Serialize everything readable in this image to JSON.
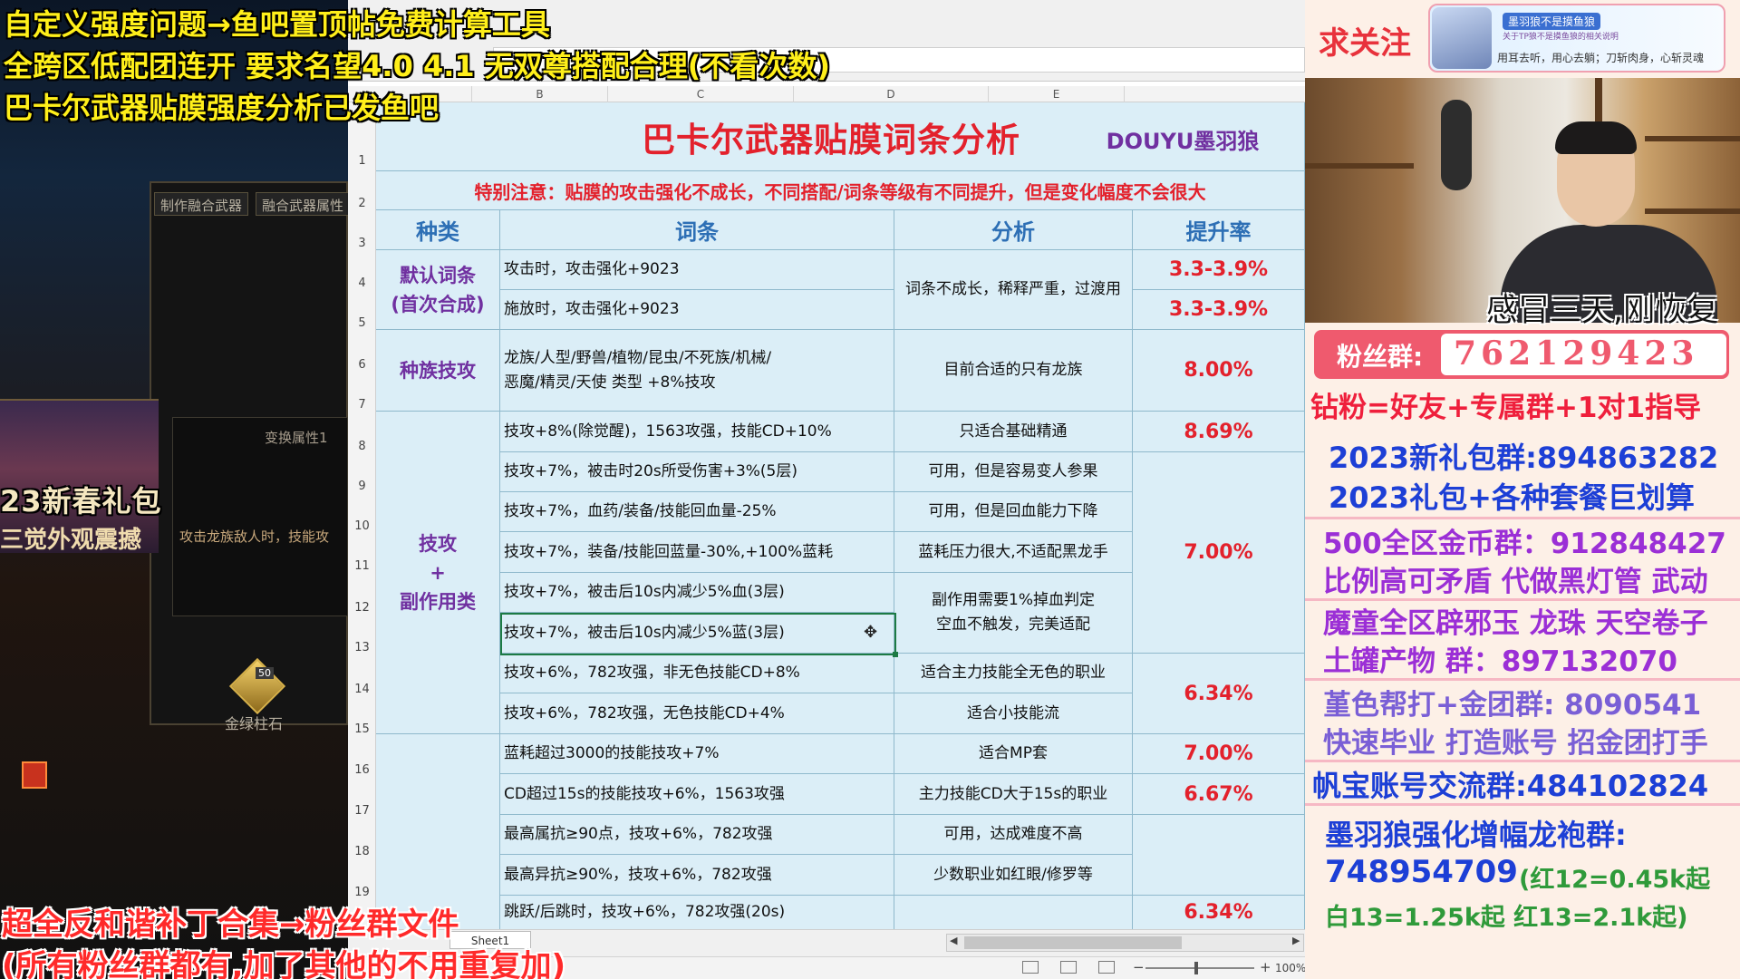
{
  "overlay": {
    "top_lines": [
      "自定义强度问题→鱼吧置顶帖免费计算工具",
      "全跨区低配团连开 要求名望4.0 4.1 无双尊搭配合理(不看次数)",
      "巴卡尔武器贴膜强度分析已发鱼吧"
    ],
    "bottom_lines": [
      "超全反和谐补丁合集→粉丝群文件",
      "(所有粉丝群都有,加了其他的不用重复加)"
    ]
  },
  "game": {
    "tab_craft": "制作融合武器",
    "tab_attr": "融合武器属性",
    "attr_label": "变换属性1",
    "attr_text": "攻击龙族敌人时，技能攻",
    "banner_title": "23新春礼包",
    "banner_sub": "三觉外观震撼",
    "gem_badge": "50",
    "gem_label": "金绿柱石"
  },
  "spreadsheet": {
    "columns": [
      "B",
      "C",
      "D",
      "E"
    ],
    "row_numbers": [
      "1",
      "2",
      "3",
      "4",
      "5",
      "6",
      "7",
      "8",
      "9",
      "10",
      "11",
      "12",
      "13",
      "14",
      "15",
      "16",
      "17",
      "18",
      "19"
    ],
    "title": "巴卡尔武器贴膜词条分析",
    "brand": "DOUYU墨羽狼",
    "note": "特别注意：贴膜的攻击强化不成长，不同搭配/词条等级有不同提升，但是变化幅度不会很大",
    "headers": {
      "category": "种类",
      "affix": "词条",
      "analysis": "分析",
      "rate": "提升率"
    },
    "categories": {
      "default": [
        "默认词条",
        "(首次合成)"
      ],
      "race": "种族技攻",
      "skill": [
        "技攻",
        "+",
        "副作用类"
      ]
    },
    "rows": [
      {
        "affix": "攻击时，攻击强化+9023"
      },
      {
        "affix": "施放时，攻击强化+9023"
      },
      {
        "affix": "龙族/人型/野兽/植物/昆虫/不死族/机械/\n恶魔/精灵/天使  类型 +8%技攻"
      },
      {
        "affix": "技攻+8%(除觉醒)，1563攻强，技能CD+10%"
      },
      {
        "affix": "技攻+7%，被击时20s所受伤害+3%(5层)"
      },
      {
        "affix": "技攻+7%，血药/装备/技能回血量-25%"
      },
      {
        "affix": "技攻+7%，装备/技能回蓝量-30%,+100%蓝耗"
      },
      {
        "affix": "技攻+7%，被击后10s内减少5%血(3层)"
      },
      {
        "affix": "技攻+7%，被击后10s内减少5%蓝(3层)"
      },
      {
        "affix": "技攻+6%，782攻强，非无色技能CD+8%"
      },
      {
        "affix": "技攻+6%，782攻强，无色技能CD+4%"
      },
      {
        "affix": "蓝耗超过3000的技能技攻+7%"
      },
      {
        "affix": "CD超过15s的技能技攻+6%，1563攻强"
      },
      {
        "affix": "最高属抗≥90点，技攻+6%，782攻强"
      },
      {
        "affix": "最高异抗≥90%，技攻+6%，782攻强"
      },
      {
        "affix": "跳跃/后跳时，技攻+6%，782攻强(20s)"
      }
    ],
    "analysis": {
      "default": "词条不成长，稀释严重，过渡用",
      "race": "目前合适的只有龙族",
      "r8": "只适合基础精通",
      "r9": "可用，但是容易变人参果",
      "r10": "可用，但是回血能力下降",
      "r11": "蓝耗压力很大,不适配黑龙手",
      "r12_13": "副作用需要1%掉血判定\n空血不触发，完美适配",
      "r14": "适合主力技能全无色的职业",
      "r15": "适合小技能流",
      "r16": "适合MP套",
      "r17": "主力技能CD大于15s的职业",
      "r18": "可用，达成难度不高",
      "r19": "少数职业如红眼/修罗等"
    },
    "rates": {
      "r4": "3.3-3.9%",
      "r5": "3.3-3.9%",
      "race": "8.00%",
      "r8": "8.69%",
      "r9_13": "7.00%",
      "r14_15": "6.34%",
      "r16": "7.00%",
      "r17": "6.67%",
      "r20": "6.34%"
    },
    "sheet_tab": "Sheet1",
    "zoom": "100%"
  },
  "promo": {
    "follow": "求关注",
    "banner_name": "墨羽狼不是摸鱼狼",
    "banner_sub": "关于TP狼不是摸鱼狼的相关说明",
    "banner_slogan": "用耳去听，用心去躺；刀斩肉身，心斩灵魂",
    "cam_caption": "感冒三天,刚恢复",
    "fan_label": "粉丝群:",
    "fan_number": "762129423",
    "lines": [
      "钻粉=好友+专属群+1对1指导",
      "2023新礼包群:894863282",
      "2023礼包+各种套餐巨划算",
      "500全区金币群：912848427",
      "比例高可矛盾 代做黑灯管 武动",
      "魔童全区辟邪玉 龙珠 天空卷子",
      "土罐产物 群：897132070",
      "堇色帮打+金团群: 8090541",
      "快速毕业 打造账号 招金团打手",
      "帆宝账号交流群:484102824",
      "墨羽狼强化增幅龙袍群:",
      "748954709",
      "(红12=0.45k起",
      "白13=1.25k起  红13=2.1k起)"
    ]
  },
  "colors": {
    "title_red": "#e3212c",
    "brand_purple": "#7030a0",
    "header_blue": "#2d6fb5",
    "cell_blue": "#dbeef7",
    "overlay_yellow": "#ffef1a"
  }
}
